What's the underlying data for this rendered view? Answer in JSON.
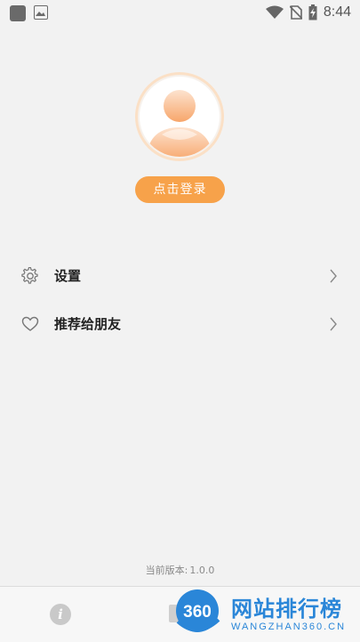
{
  "status_bar": {
    "time": "8:44",
    "icons": [
      "notification-square-icon",
      "image-icon",
      "wifi-icon",
      "no-sim-icon",
      "battery-charging-icon"
    ]
  },
  "profile": {
    "avatar_icon": "user-avatar-icon",
    "login_label": "点击登录"
  },
  "menu": {
    "items": [
      {
        "label": "设置",
        "icon": "gear-icon"
      },
      {
        "label": "推荐给朋友",
        "icon": "heart-icon"
      }
    ]
  },
  "footer": {
    "version_label": "当前版本:",
    "version_number": "1.0.0"
  },
  "tabbar": {
    "icons": [
      "info-icon",
      "document-icon"
    ]
  },
  "watermark": {
    "logo_text": "360",
    "title": "网站排行榜",
    "subtitle": "WANGZHAN360.CN"
  },
  "colors": {
    "accent": "#f7a24a",
    "background": "#f2f2f2",
    "watermark": "#2a86d8"
  }
}
